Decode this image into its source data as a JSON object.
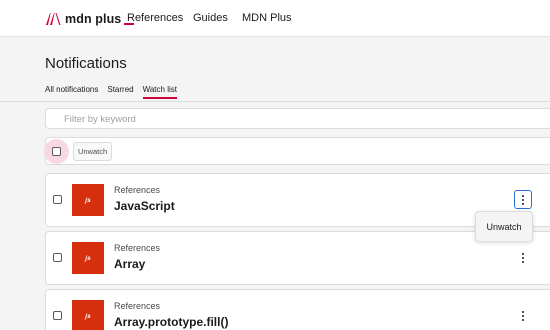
{
  "brand": {
    "name": "mdn plus",
    "accent": "#d30038"
  },
  "nav": {
    "items": [
      "References",
      "Guides",
      "MDN Plus"
    ]
  },
  "page": {
    "title": "Notifications"
  },
  "tabs": [
    {
      "label": "All notifications",
      "active": false
    },
    {
      "label": "Starred",
      "active": false
    },
    {
      "label": "Watch list",
      "active": true
    }
  ],
  "filter": {
    "placeholder": "Filter by keyword",
    "value": ""
  },
  "bulk": {
    "unwatch_label": "Unwatch",
    "select_all_checked": false
  },
  "items": [
    {
      "icon_text": "js",
      "section": "References",
      "title": "JavaScript",
      "checked": false,
      "menu_open": true
    },
    {
      "icon_text": "js",
      "section": "References",
      "title": "Array",
      "checked": false,
      "menu_open": false
    },
    {
      "icon_text": "js",
      "section": "References",
      "title": "Array.prototype.fill()",
      "checked": false,
      "menu_open": false
    }
  ],
  "item_menu": {
    "unwatch_label": "Unwatch"
  },
  "icons": {
    "logo": "mdn-m-logo-icon",
    "checkbox": "checkbox-icon",
    "more": "kebab-menu-icon"
  },
  "colors": {
    "tile": "#d52f0e",
    "focus": "#2e6fd1"
  }
}
